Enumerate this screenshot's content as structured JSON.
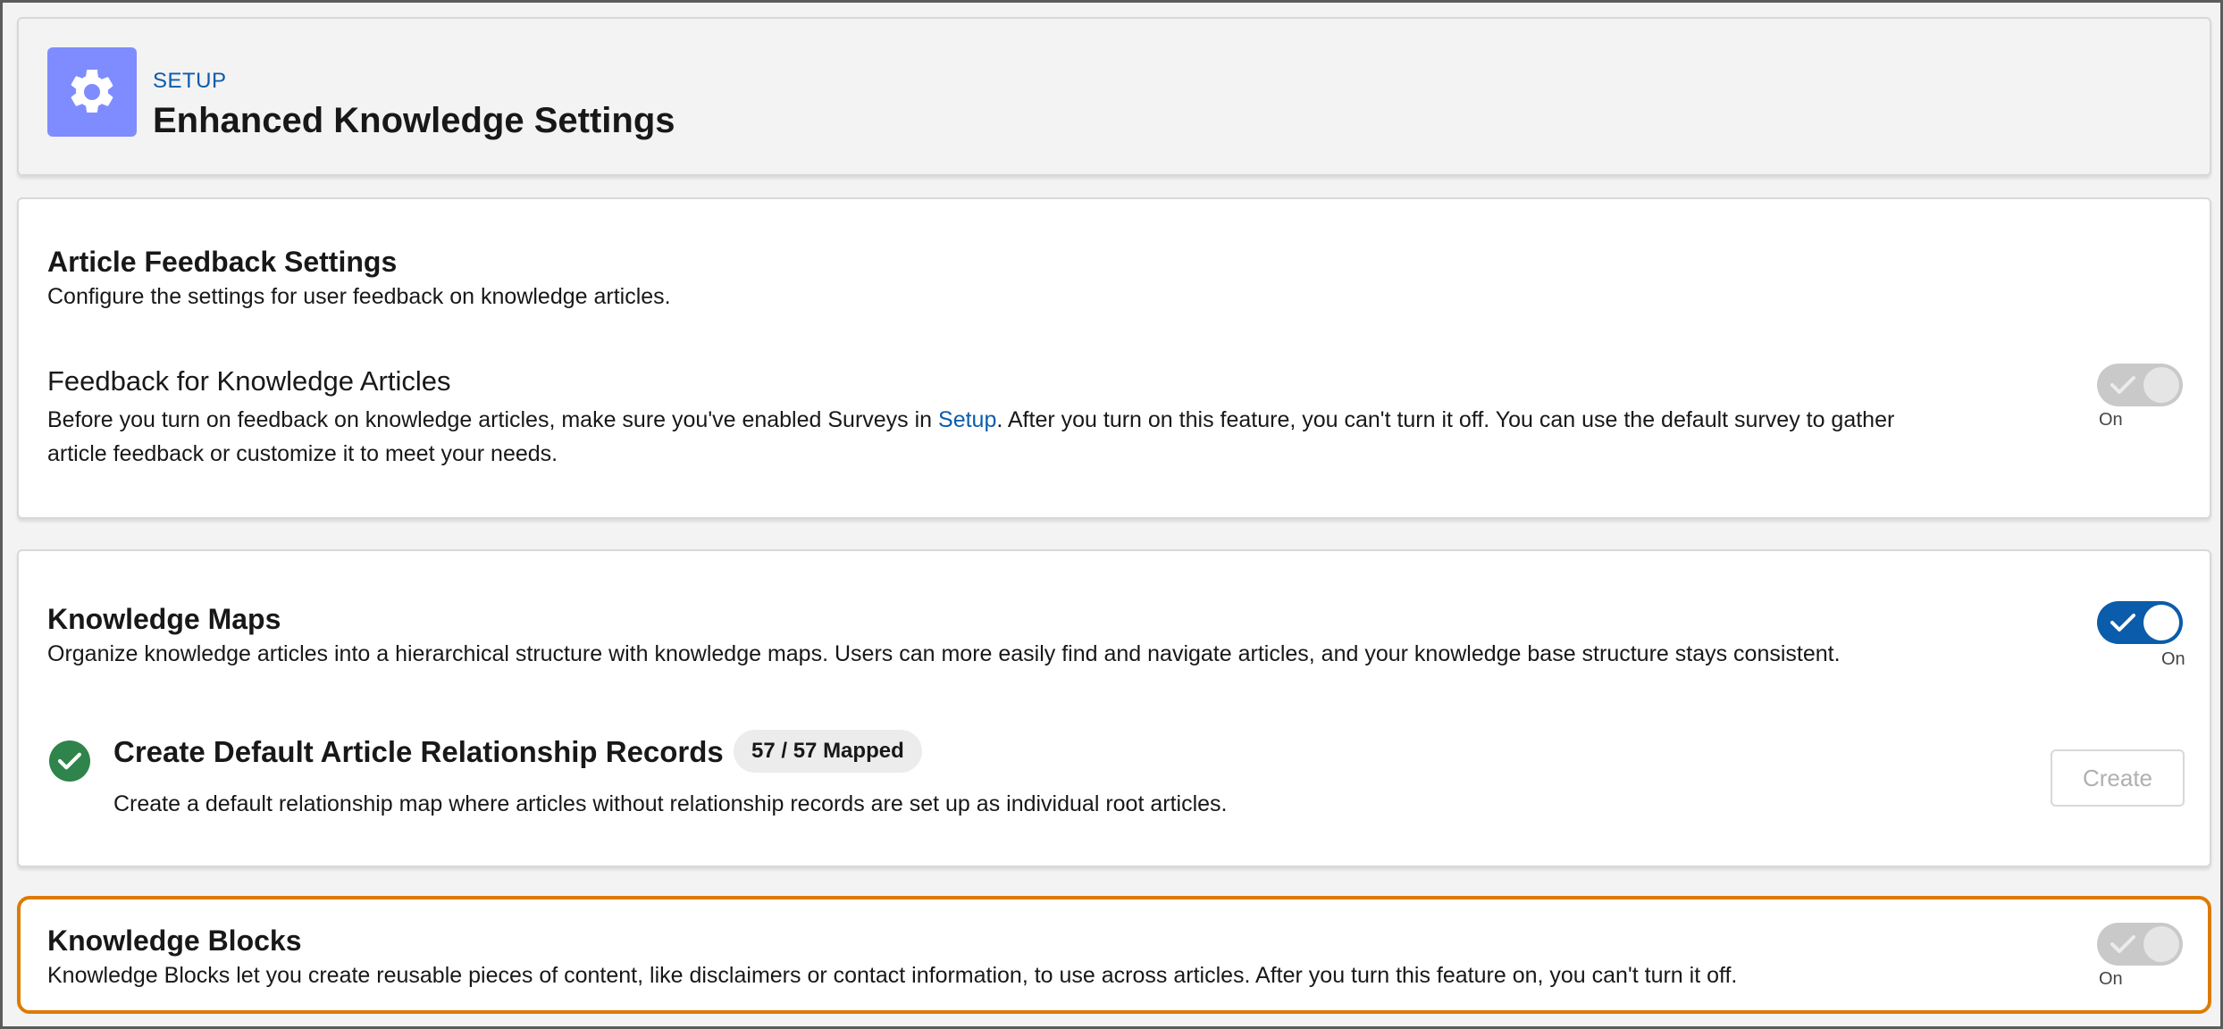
{
  "header": {
    "eyebrow": "SETUP",
    "title": "Enhanced Knowledge Settings",
    "icon": "gear-icon",
    "icon_bg": "#7f8cff"
  },
  "feedback": {
    "title": "Article Feedback Settings",
    "description": "Configure the settings for user feedback on knowledge articles.",
    "setting_title": "Feedback for Knowledge Articles",
    "setting_text_before": "Before you turn on feedback on knowledge articles, make sure you've enabled Surveys in ",
    "setting_link": "Setup",
    "setting_text_after": ". After you turn on this feature, you can't turn it off. You can use the default survey to gather",
    "setting_text_line2": "article feedback or customize it to meet your needs.",
    "toggle_label": "On",
    "toggle_state": "on-disabled"
  },
  "maps": {
    "title": "Knowledge Maps",
    "description": "Organize knowledge articles into a hierarchical structure with knowledge maps. Users can more easily find and navigate articles, and your knowledge base structure stays consistent.",
    "toggle_label": "On",
    "toggle_state": "on",
    "default_records": {
      "title": "Create Default Article Relationship Records",
      "badge": "57 / 57 Mapped",
      "description": "Create a default relationship map where articles without relationship records are set up as individual root articles.",
      "button": "Create",
      "status_icon": "success-check-icon"
    }
  },
  "blocks": {
    "title": "Knowledge Blocks",
    "description": "Knowledge Blocks let you create reusable pieces of content, like disclaimers or contact information, to use across articles. After you turn this feature on, you can't turn it off.",
    "toggle_label": "On",
    "toggle_state": "on-disabled",
    "highlight_color": "#dd7a01"
  },
  "colors": {
    "brand_blue": "#0b5cab",
    "success_green": "#2e844a"
  }
}
